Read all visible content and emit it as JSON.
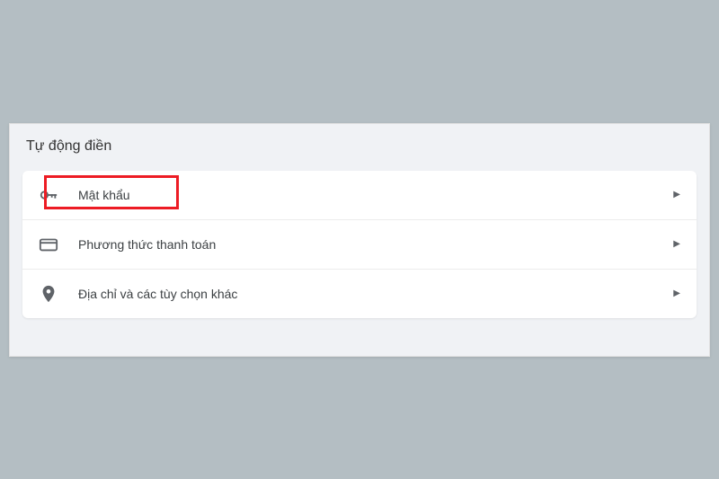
{
  "section": {
    "title": "Tự động điền"
  },
  "rows": {
    "passwords": {
      "label": "Mật khẩu"
    },
    "payments": {
      "label": "Phương thức thanh toán"
    },
    "addresses": {
      "label": "Địa chỉ và các tùy chọn khác"
    }
  }
}
